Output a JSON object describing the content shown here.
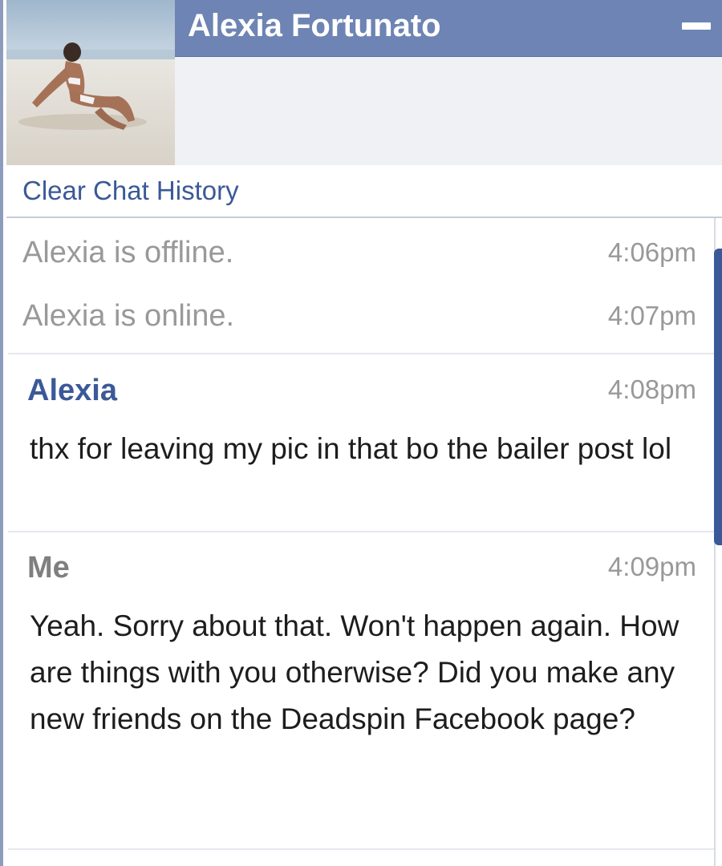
{
  "chat": {
    "contact_name": "Alexia Fortunato",
    "minimize_label": "minimize",
    "clear_history": "Clear Chat History"
  },
  "status_events": [
    {
      "text": "Alexia is offline.",
      "time": "4:06pm"
    },
    {
      "text": "Alexia is online.",
      "time": "4:07pm"
    }
  ],
  "messages": [
    {
      "sender": "Alexia",
      "time": "4:08pm",
      "body": "thx for leaving my pic in that bo the bailer post lol"
    },
    {
      "sender": "Me",
      "time": "4:09pm",
      "body": "Yeah. Sorry about that. Won't happen again. How are things with you otherwise? Did you make any new friends on the Deadspin Facebook page?"
    }
  ],
  "colors": {
    "titlebar": "#6d84b4",
    "link": "#3b5998",
    "muted": "#999999"
  }
}
